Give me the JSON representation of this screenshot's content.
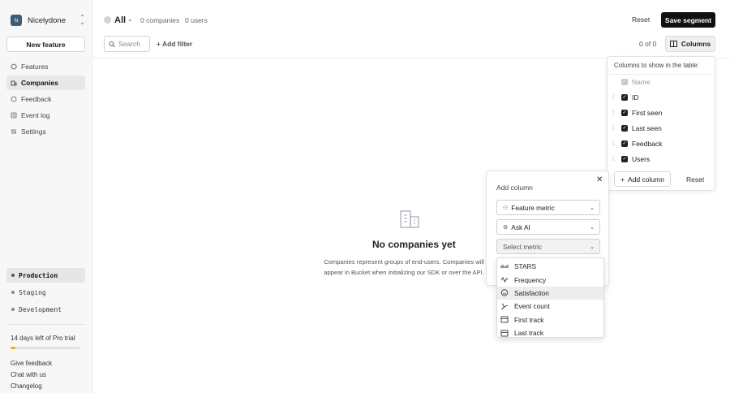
{
  "sidebar": {
    "org": {
      "initial": "N",
      "name": "Nicelydone"
    },
    "new_feature_label": "New feature",
    "nav": [
      {
        "label": "Features",
        "icon": "features-icon"
      },
      {
        "label": "Companies",
        "icon": "companies-icon",
        "active": true
      },
      {
        "label": "Feedback",
        "icon": "feedback-icon"
      },
      {
        "label": "Event log",
        "icon": "event-log-icon"
      },
      {
        "label": "Settings",
        "icon": "settings-icon"
      }
    ],
    "environments": [
      {
        "label": "Production",
        "active": true
      },
      {
        "label": "Staging"
      },
      {
        "label": "Development"
      }
    ],
    "trial": {
      "text": "14 days left of Pro trial",
      "progress_fraction": 0.07
    },
    "footer_links": [
      "Give feedback",
      "Chat with us",
      "Changelog"
    ]
  },
  "header": {
    "segment_name": "All",
    "companies_count": "0 companies",
    "users_count": "0 users",
    "reset_label": "Reset",
    "save_segment_label": "Save segment",
    "search_placeholder": "Search",
    "add_filter_label": "Add filter",
    "pager_text": "0 of 0",
    "columns_label": "Columns"
  },
  "empty_state": {
    "title": "No companies yet",
    "description_line1": "Companies represent groups of end-users. Companies will",
    "description_line2": "appear in Bucket when initializing our SDK or over the API."
  },
  "columns_popover": {
    "title": "Columns to show in the table:",
    "columns": [
      {
        "label": "Name",
        "checked": true,
        "disabled": true
      },
      {
        "label": "ID",
        "checked": true
      },
      {
        "label": "First seen",
        "checked": true
      },
      {
        "label": "Last seen",
        "checked": true
      },
      {
        "label": "Feedback",
        "checked": true
      },
      {
        "label": "Users",
        "checked": true
      }
    ],
    "add_column_label": "Add column",
    "reset_label": "Reset"
  },
  "add_column_popover": {
    "title": "Add column",
    "feature_metric_label": "Feature metric",
    "ask_ai_label": "Ask AI",
    "select_metric_placeholder": "Select metric",
    "metric_options": [
      {
        "label": "STARS",
        "icon": "stars-icon"
      },
      {
        "label": "Frequency",
        "icon": "frequency-icon"
      },
      {
        "label": "Satisfaction",
        "icon": "satisfaction-icon",
        "hover": true
      },
      {
        "label": "Event count",
        "icon": "event-count-icon"
      },
      {
        "label": "First track",
        "icon": "first-track-icon"
      },
      {
        "label": "Last track",
        "icon": "last-track-icon"
      }
    ]
  },
  "colors": {
    "primary_button": "#111111",
    "trial_progress": "#f0b21d",
    "org_avatar": "#3d5c7a"
  }
}
